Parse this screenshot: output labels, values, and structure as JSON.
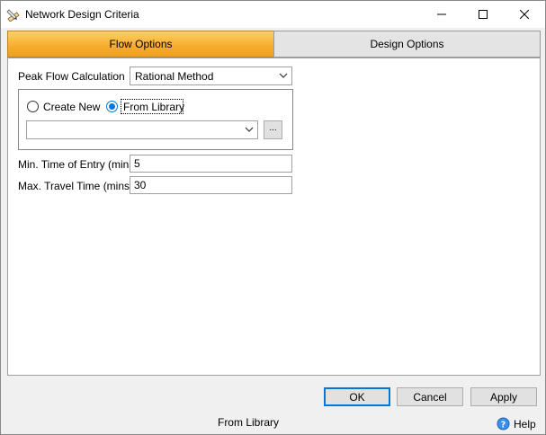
{
  "window": {
    "title": "Network Design Criteria",
    "icon": "pencil-ruler-icon"
  },
  "tabs": [
    {
      "label": "Flow Options",
      "active": true
    },
    {
      "label": "Design Options",
      "active": false
    }
  ],
  "flow": {
    "peak_flow_label": "Peak Flow Calculation",
    "peak_flow_value": "Rational Method",
    "source": {
      "create_new_label": "Create New",
      "from_library_label": "From Library",
      "selected": "From Library",
      "library_value": "",
      "browse_label": "..."
    },
    "min_time_label": "Min. Time of Entry (mins)",
    "min_time_value": "5",
    "max_travel_label": "Max. Travel Time (mins)",
    "max_travel_value": "30"
  },
  "buttons": {
    "ok": "OK",
    "cancel": "Cancel",
    "apply": "Apply"
  },
  "status": {
    "text": "From Library",
    "help_label": "Help"
  },
  "colors": {
    "active_tab": "#f6ac2c",
    "accent": "#0078d7"
  }
}
